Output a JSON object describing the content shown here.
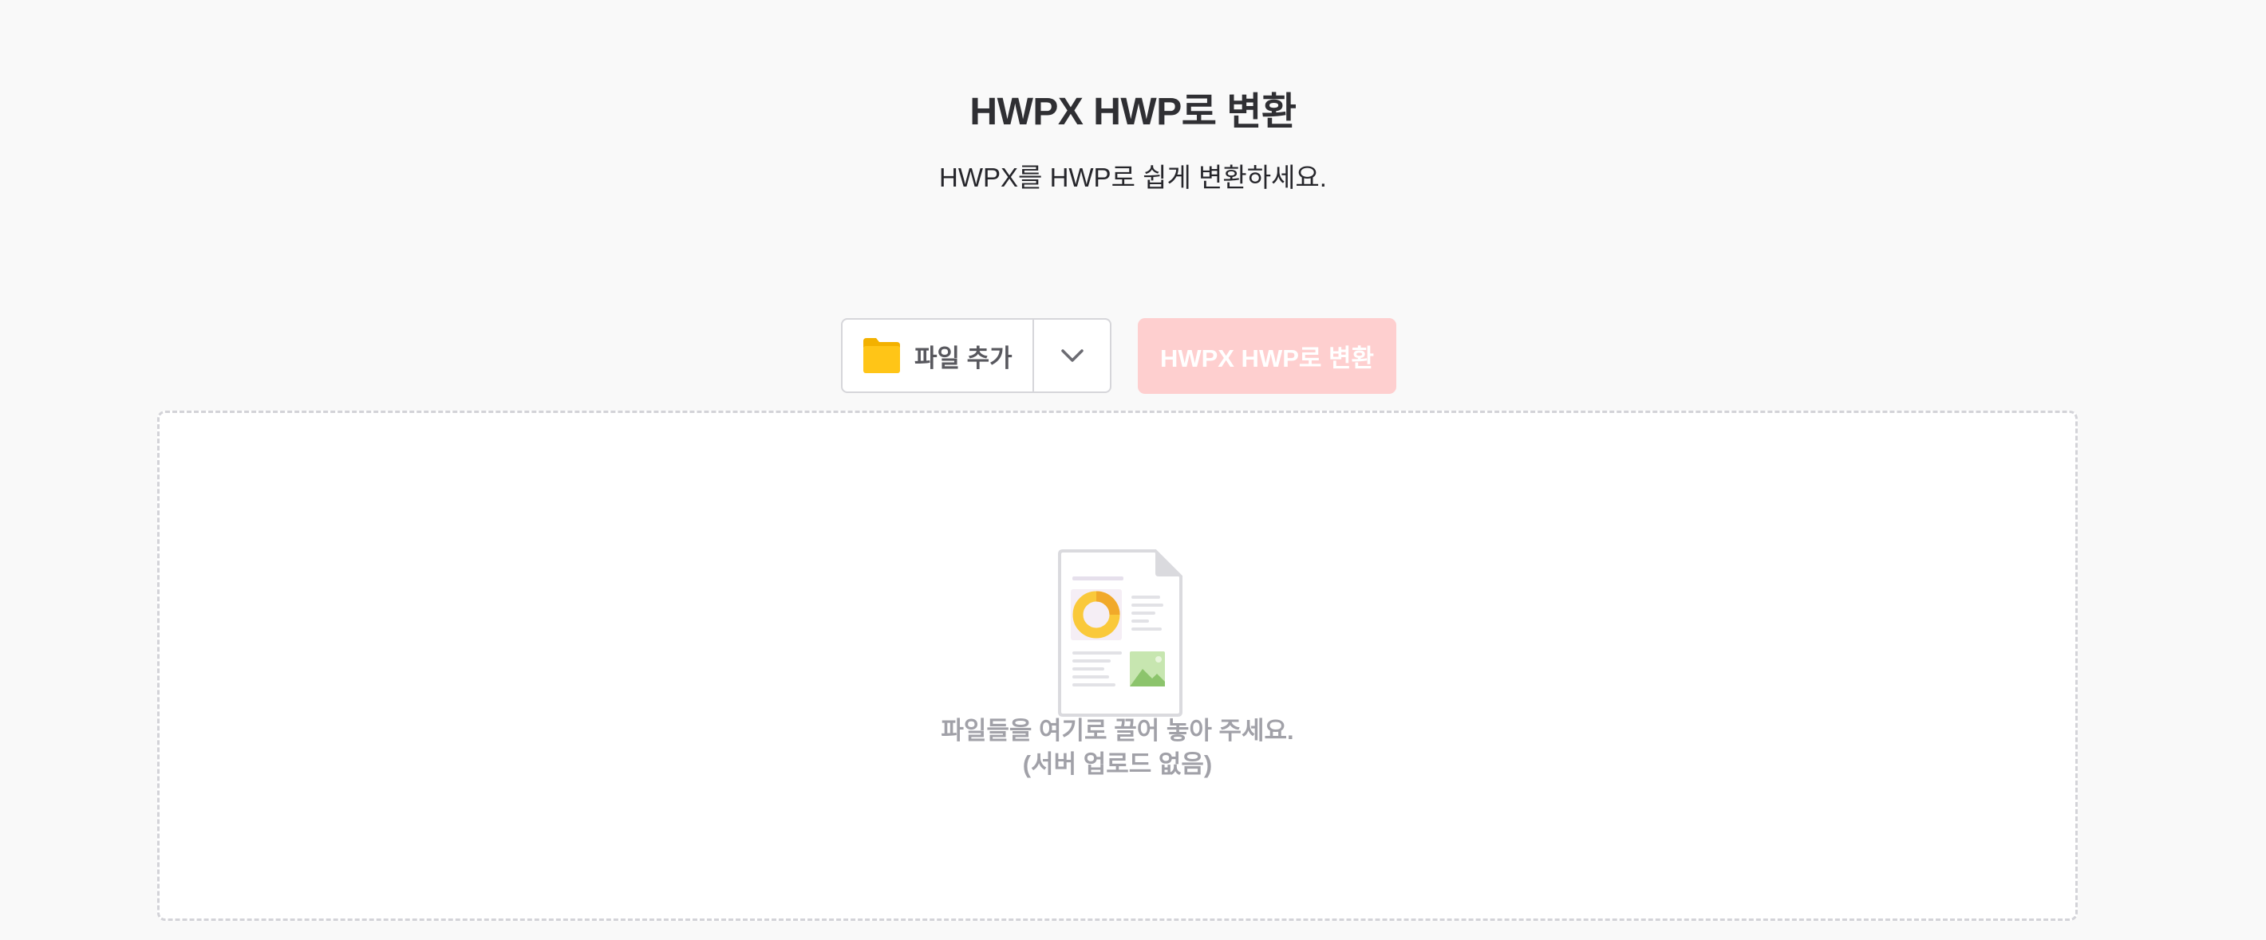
{
  "page": {
    "title": "HWPX HWP로 변환",
    "subtitle": "HWPX를 HWP로 쉽게 변환하세요."
  },
  "toolbar": {
    "add_file_label": "파일 추가",
    "convert_label": "HWPX HWP로 변환"
  },
  "dropzone": {
    "line1": "파일들을 여기로 끌어 놓아 주세요.",
    "line2": "(서버 업로드 없음)"
  },
  "colors": {
    "accent_disabled": "#fecfcf",
    "folder": "#ffc517",
    "background": "#f9f9f9"
  },
  "icons": {
    "add": "folder-icon",
    "dropdown": "chevron-down-icon",
    "empty_state": "document-illustration-icon"
  }
}
